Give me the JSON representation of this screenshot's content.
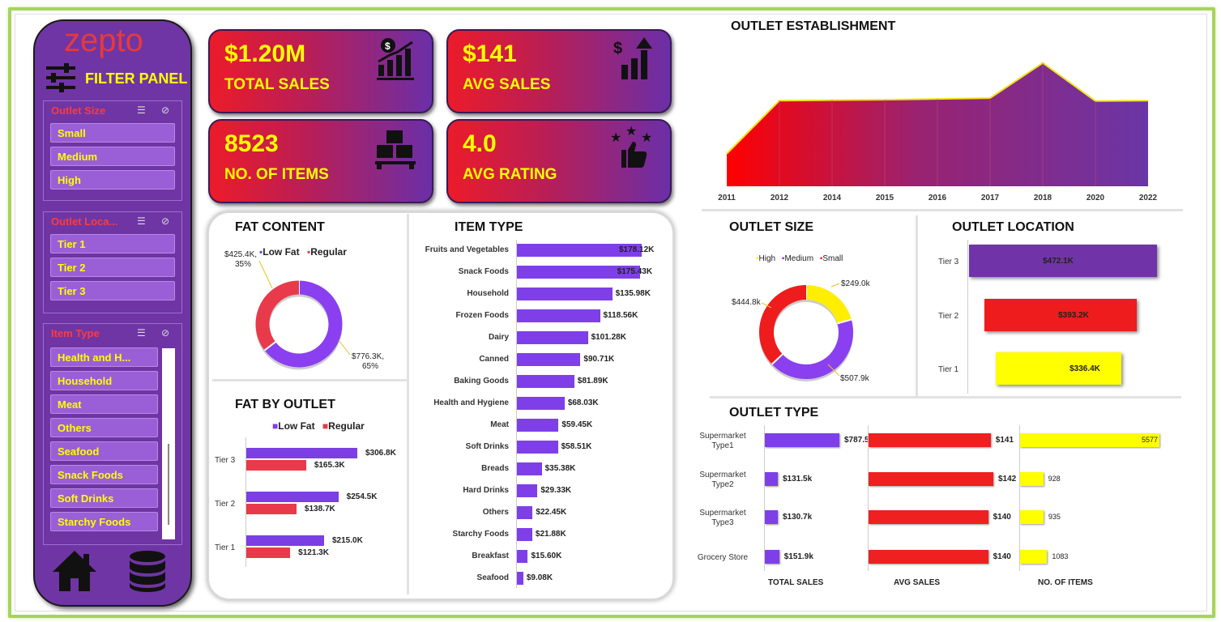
{
  "sidebar": {
    "logo": "zepto",
    "filter_title": "FILTER PANEL",
    "outlet_size": {
      "title": "Outlet Size",
      "items": [
        "Small",
        "Medium",
        "High"
      ]
    },
    "outlet_location": {
      "title": "Outlet Loca...",
      "items": [
        "Tier 1",
        "Tier 2",
        "Tier 3"
      ]
    },
    "item_type": {
      "title": "Item Type",
      "items": [
        "Health and H...",
        "Household",
        "Meat",
        "Others",
        "Seafood",
        "Snack Foods",
        "Soft Drinks",
        "Starchy Foods"
      ]
    }
  },
  "kpis": [
    {
      "value": "$1.20M",
      "label": "TOTAL SALES",
      "icon": "sales-chart-icon"
    },
    {
      "value": "$141",
      "label": "AVG SALES",
      "icon": "growth-arrow-icon"
    },
    {
      "value": "8523",
      "label": "NO. OF ITEMS",
      "icon": "boxes-icon"
    },
    {
      "value": "4.0",
      "label": "AVG RATING",
      "icon": "stars-thumbs-up-icon"
    }
  ],
  "colors": {
    "purple": "#7b3fe4",
    "red": "#ee2a2a",
    "yellow": "#ffff00",
    "kpi_start": "#ec1b2a",
    "kpi_end": "#6a2fa8"
  },
  "chart_data": [
    {
      "type": "area",
      "title": "OUTLET ESTABLISHMENT",
      "x": [
        "2011",
        "2012",
        "2014",
        "2015",
        "2016",
        "2017",
        "2018",
        "2020",
        "2022"
      ],
      "values": [
        78,
        205,
        206,
        207,
        209,
        211,
        295,
        204,
        205
      ]
    },
    {
      "type": "pie",
      "title": "FAT CONTENT",
      "series": [
        {
          "name": "Low Fat",
          "label": "$776.3K,",
          "percent": "65%",
          "value": 776.3
        },
        {
          "name": "Regular",
          "label": "$425.4K,",
          "percent": "35%",
          "value": 425.4
        }
      ]
    },
    {
      "type": "bar",
      "title": "ITEM TYPE",
      "categories": [
        "Fruits and Vegetables",
        "Snack Foods",
        "Household",
        "Frozen Foods",
        "Dairy",
        "Canned",
        "Baking Goods",
        "Health and Hygiene",
        "Meat",
        "Soft Drinks",
        "Breads",
        "Hard Drinks",
        "Others",
        "Starchy Foods",
        "Breakfast",
        "Seafood"
      ],
      "values": [
        178.12,
        175.43,
        135.98,
        118.56,
        101.28,
        90.71,
        81.89,
        68.03,
        59.45,
        58.51,
        35.38,
        29.33,
        22.45,
        21.88,
        15.6,
        9.08
      ],
      "labels": [
        "$178.12K",
        "$175.43K",
        "$135.98K",
        "$118.56K",
        "$101.28K",
        "$90.71K",
        "$81.89K",
        "$68.03K",
        "$59.45K",
        "$58.51K",
        "$35.38K",
        "$29.33K",
        "$22.45K",
        "$21.88K",
        "$15.60K",
        "$9.08K"
      ]
    },
    {
      "type": "bar",
      "title": "FAT BY OUTLET",
      "categories": [
        "Tier 3",
        "Tier 2",
        "Tier 1"
      ],
      "series": [
        {
          "name": "Low Fat",
          "values": [
            306.8,
            254.5,
            215.0
          ],
          "labels": [
            "$306.8K",
            "$254.5K",
            "$215.0K"
          ]
        },
        {
          "name": "Regular",
          "values": [
            165.3,
            138.7,
            121.3
          ],
          "labels": [
            "$165.3K",
            "$138.7K",
            "$121.3K"
          ]
        }
      ]
    },
    {
      "type": "pie",
      "title": "OUTLET SIZE",
      "series": [
        {
          "name": "High",
          "label": "$249.0k",
          "value": 249.0
        },
        {
          "name": "Medium",
          "label": "$507.9k",
          "value": 507.9
        },
        {
          "name": "Small",
          "label": "$444.8k",
          "value": 444.8
        }
      ]
    },
    {
      "type": "bar",
      "title": "OUTLET LOCATION",
      "categories": [
        "Tier 3",
        "Tier 2",
        "Tier 1"
      ],
      "values": [
        472.1,
        393.2,
        336.4
      ],
      "labels": [
        "$472.1K",
        "$393.2K",
        "$336.4K"
      ]
    },
    {
      "type": "bar",
      "title": "OUTLET TYPE",
      "categories": [
        "Supermarket Type1",
        "Supermarket Type2",
        "Supermarket Type3",
        "Grocery Store"
      ],
      "series": [
        {
          "name": "TOTAL SALES",
          "values": [
            787.5,
            131.5,
            130.7,
            151.9
          ],
          "labels": [
            "$787.5k",
            "$131.5k",
            "$130.7k",
            "$151.9k"
          ]
        },
        {
          "name": "AVG SALES",
          "values": [
            141,
            142,
            140,
            140
          ],
          "labels": [
            "$141",
            "$142",
            "$140",
            "$140"
          ]
        },
        {
          "name": "NO. OF ITEMS",
          "values": [
            5577,
            928,
            935,
            1083
          ],
          "labels": [
            "5577",
            "928",
            "935",
            "1083"
          ]
        }
      ]
    }
  ]
}
